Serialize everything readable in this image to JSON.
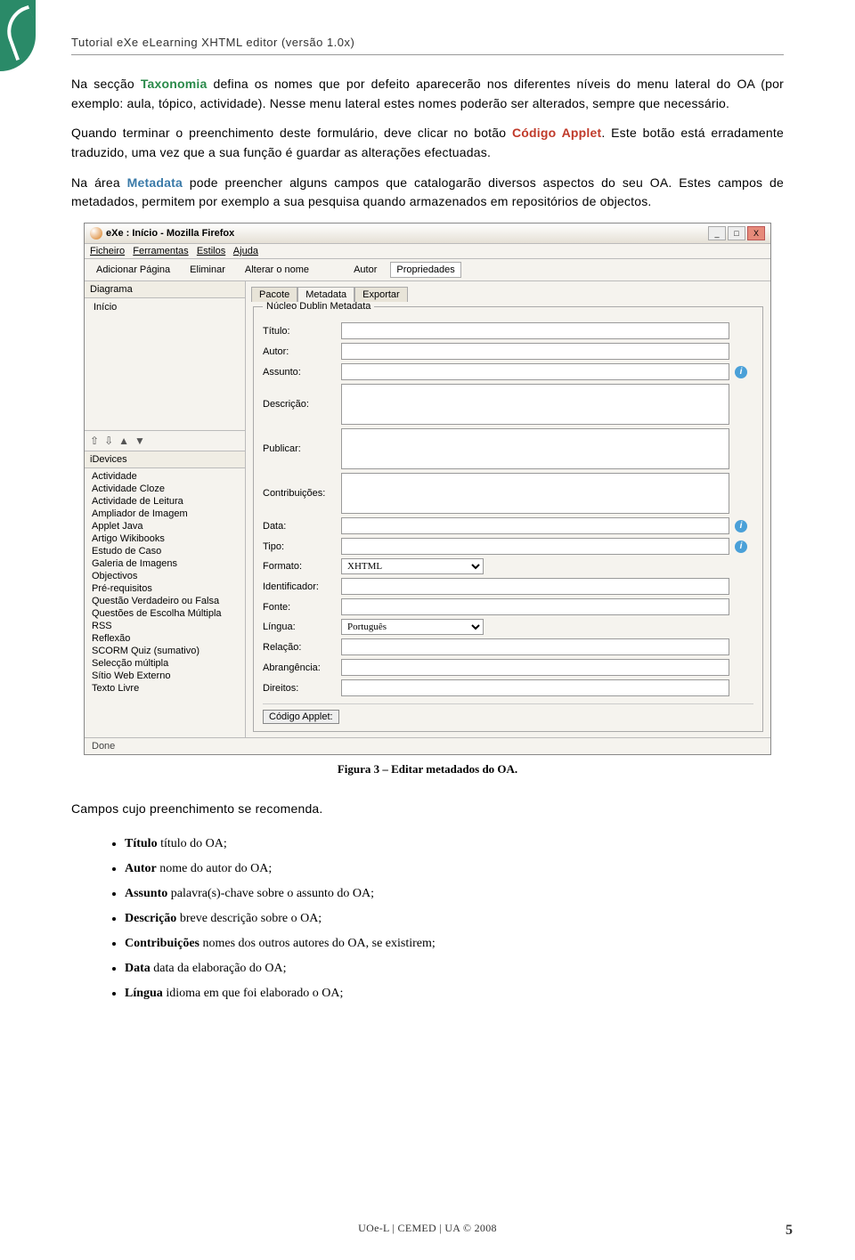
{
  "header": "Tutorial eXe eLearning XHTML editor (versão 1.0x)",
  "para1": {
    "a": "Na secção ",
    "b": "Taxonomia",
    "c": " defina os nomes que por defeito aparecerão nos diferentes níveis do menu lateral do OA (por exemplo: aula, tópico, actividade). Nesse menu lateral estes nomes poderão ser alterados, sempre que necessário."
  },
  "para2": {
    "a": "Quando terminar o preenchimento deste formulário, deve clicar no botão ",
    "b": "Código Applet",
    "c": ". Este botão está erradamente traduzido, uma vez que a sua função é guardar as alterações efectuadas."
  },
  "para3": {
    "a": "Na área ",
    "b": "Metadata",
    "c": " pode preencher alguns campos que catalogarão diversos aspectos do seu OA. Estes campos de metadados, permitem por exemplo a sua pesquisa quando armazenados em repositórios de objectos."
  },
  "app": {
    "title": "eXe : Início - Mozilla Firefox",
    "win": {
      "min": "_",
      "max": "□",
      "close": "X"
    },
    "menu": {
      "f": "Ficheiro",
      "t": "Ferramentas",
      "e": "Estilos",
      "a": "Ajuda"
    },
    "toolbar": {
      "add": "Adicionar Página",
      "del": "Eliminar",
      "ren": "Alterar o nome",
      "autor": "Autor",
      "prop": "Propriedades"
    },
    "left": {
      "diagrama": "Diagrama",
      "inicio": "Início",
      "devices_h": "iDevices",
      "devices": [
        "Actividade",
        "Actividade Cloze",
        "Actividade de Leitura",
        "Ampliador de Imagem",
        "Applet Java",
        "Artigo Wikibooks",
        "Estudo de Caso",
        "Galeria de Imagens",
        "Objectivos",
        "Pré-requisitos",
        "Questão Verdadeiro ou Falsa",
        "Questões de Escolha Múltipla",
        "RSS",
        "Reflexão",
        "SCORM Quiz (sumativo)",
        "Selecção múltipla",
        "Sítio Web Externo",
        "Texto Livre"
      ]
    },
    "right": {
      "tabs": {
        "pacote": "Pacote",
        "metadata": "Metadata",
        "exportar": "Exportar"
      },
      "legend": "Núcleo Dublin Metadata",
      "labels": {
        "titulo": "Título:",
        "autor": "Autor:",
        "assunto": "Assunto:",
        "descricao": "Descrição:",
        "publicar": "Publicar:",
        "contrib": "Contribuições:",
        "data": "Data:",
        "tipo": "Tipo:",
        "formato": "Formato:",
        "identificador": "Identificador:",
        "fonte": "Fonte:",
        "lingua": "Língua:",
        "relacao": "Relação:",
        "abrang": "Abrangência:",
        "direitos": "Direitos:"
      },
      "formato_val": "XHTML",
      "lingua_val": "Português",
      "button": "Código Applet:"
    },
    "status": "Done"
  },
  "caption": "Figura 3 – Editar metadados do OA.",
  "rec_title": "Campos cujo preenchimento se recomenda.",
  "items": [
    {
      "b": "Título",
      "t": " título do OA;"
    },
    {
      "b": "Autor",
      "t": " nome do autor do OA;"
    },
    {
      "b": "Assunto",
      "t": " palavra(s)-chave sobre o assunto do OA;"
    },
    {
      "b": "Descrição",
      "t": " breve descrição sobre o OA;"
    },
    {
      "b": "Contribuições",
      "t": " nomes dos outros autores do OA, se existirem;"
    },
    {
      "b": "Data",
      "t": " data da elaboração do OA;"
    },
    {
      "b": "Língua",
      "t": " idioma em que foi elaborado o OA;"
    }
  ],
  "footer": "UOe-L | CEMED | UA © 2008",
  "pagenum": "5"
}
